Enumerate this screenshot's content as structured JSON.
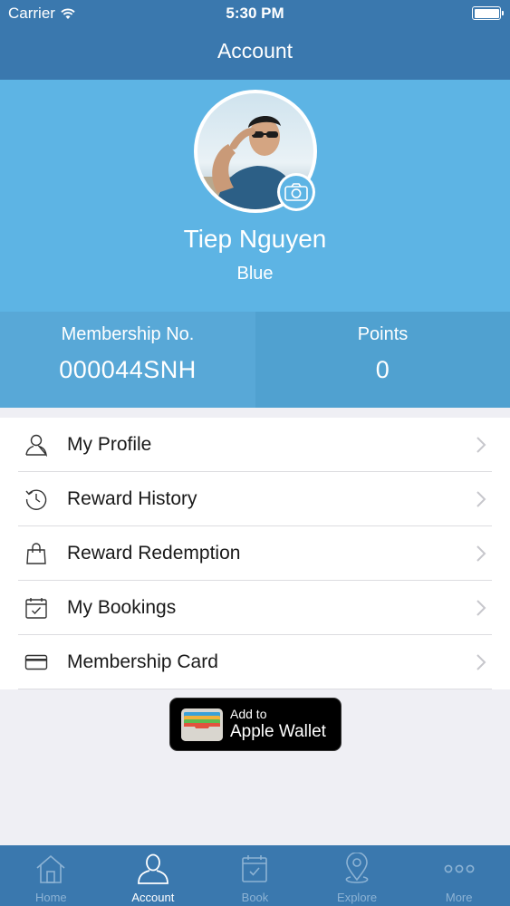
{
  "status_bar": {
    "carrier": "Carrier",
    "time": "5:30 PM",
    "battery_level": 1.0
  },
  "nav": {
    "title": "Account"
  },
  "profile": {
    "name": "Tiep Nguyen",
    "tier": "Blue"
  },
  "stats": {
    "membership_label": "Membership No.",
    "membership_value": "000044SNH",
    "points_label": "Points",
    "points_value": "0"
  },
  "menu": [
    {
      "label": "My Profile",
      "icon": "person-icon"
    },
    {
      "label": "Reward History",
      "icon": "history-clock-icon"
    },
    {
      "label": "Reward Redemption",
      "icon": "shopping-bag-icon"
    },
    {
      "label": "My Bookings",
      "icon": "calendar-check-icon"
    },
    {
      "label": "Membership Card",
      "icon": "credit-card-icon"
    }
  ],
  "wallet": {
    "line1": "Add to",
    "line2": "Apple Wallet"
  },
  "tabs": [
    {
      "label": "Home",
      "icon": "home-icon",
      "active": false
    },
    {
      "label": "Account",
      "icon": "person-icon",
      "active": true
    },
    {
      "label": "Book",
      "icon": "calendar-check-icon",
      "active": false
    },
    {
      "label": "Explore",
      "icon": "map-pin-icon",
      "active": false
    },
    {
      "label": "More",
      "icon": "more-dots-icon",
      "active": false
    }
  ],
  "colors": {
    "nav_bar": "#3a78ae",
    "profile_bg": "#5db4e4",
    "stats_bg": "#58a8d7",
    "tab_inactive": "#8db3d4",
    "tab_active": "#ffffff"
  }
}
